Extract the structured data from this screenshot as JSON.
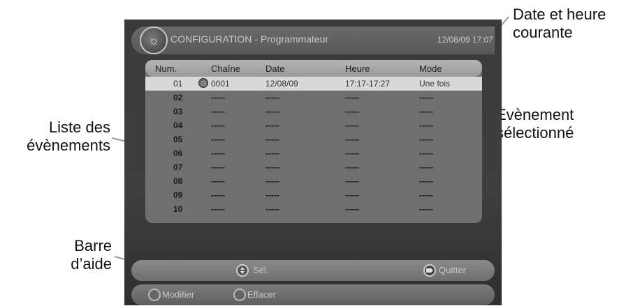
{
  "annotations": {
    "date_heure_line1": "Date et heure",
    "date_heure_line2": "courante",
    "liste_line1": "Liste des",
    "liste_line2": "évènements",
    "evenement_line1": "Evènement",
    "evenement_line2": "sélectionné",
    "barre_line1": "Barre",
    "barre_line2": "d’aide"
  },
  "screen": {
    "title": "CONFIGURATION - Programmateur",
    "datetime": "12/08/09 17:07",
    "columns": [
      "Num.",
      "Chaîne",
      "Date",
      "Heure",
      "Mode"
    ],
    "rows": [
      {
        "num": "01",
        "chaine": "0001",
        "date": "12/08/09",
        "heure": "17:17-17:27",
        "mode": "Une fois"
      },
      {
        "num": "02",
        "chaine": "-----",
        "date": "-----",
        "heure": "-----",
        "mode": "-----"
      },
      {
        "num": "03",
        "chaine": "-----",
        "date": "-----",
        "heure": "-----",
        "mode": "-----"
      },
      {
        "num": "04",
        "chaine": "-----",
        "date": "-----",
        "heure": "-----",
        "mode": "-----"
      },
      {
        "num": "05",
        "chaine": "-----",
        "date": "-----",
        "heure": "-----",
        "mode": "-----"
      },
      {
        "num": "06",
        "chaine": "-----",
        "date": "-----",
        "heure": "-----",
        "mode": "-----"
      },
      {
        "num": "07",
        "chaine": "-----",
        "date": "-----",
        "heure": "-----",
        "mode": "-----"
      },
      {
        "num": "08",
        "chaine": "-----",
        "date": "-----",
        "heure": "-----",
        "mode": "-----"
      },
      {
        "num": "09",
        "chaine": "-----",
        "date": "-----",
        "heure": "-----",
        "mode": "-----"
      },
      {
        "num": "10",
        "chaine": "-----",
        "date": "-----",
        "heure": "-----",
        "mode": "-----"
      }
    ],
    "help": {
      "sel": "Sél.",
      "quitter": "Quitter",
      "modifier": "Modifier",
      "effacer": "Effacer"
    }
  }
}
